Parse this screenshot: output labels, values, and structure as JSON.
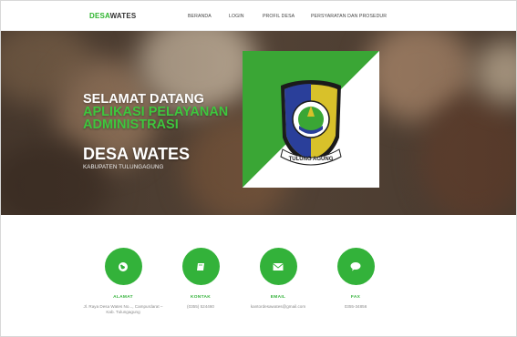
{
  "navbar": {
    "brand_part1": "DESA",
    "brand_part2": "WATES",
    "links": [
      "BERANDA",
      "LOGIN",
      "PROFIL DESA",
      "PERSYARATAN DAN PROSEDUR"
    ]
  },
  "hero": {
    "line1": "SELAMAT DATANG",
    "line2": "APLIKASI PELAYANAN",
    "line3": "ADMINISTRASI",
    "title": "DESA WATES",
    "subtitle": "KABUPATEN TULUNGAGUNG",
    "emblem_text": "TULUNG AGUNG"
  },
  "features": [
    {
      "title": "ALAMAT",
      "text": "Jl. Raya Desa Wates No..., Campurdarat – Kab. Tulungagung",
      "icon": "globe-icon"
    },
    {
      "title": "KONTAK",
      "text": "(0355) 524460",
      "icon": "book-icon"
    },
    {
      "title": "EMAIL",
      "text": "kantordesawates@gmail.com",
      "icon": "envelope-icon"
    },
    {
      "title": "FAX",
      "text": "0355-34856",
      "icon": "chat-bubble-icon"
    }
  ],
  "colors": {
    "accent_green": "#33b23a",
    "brand_green": "#2fb52f"
  }
}
